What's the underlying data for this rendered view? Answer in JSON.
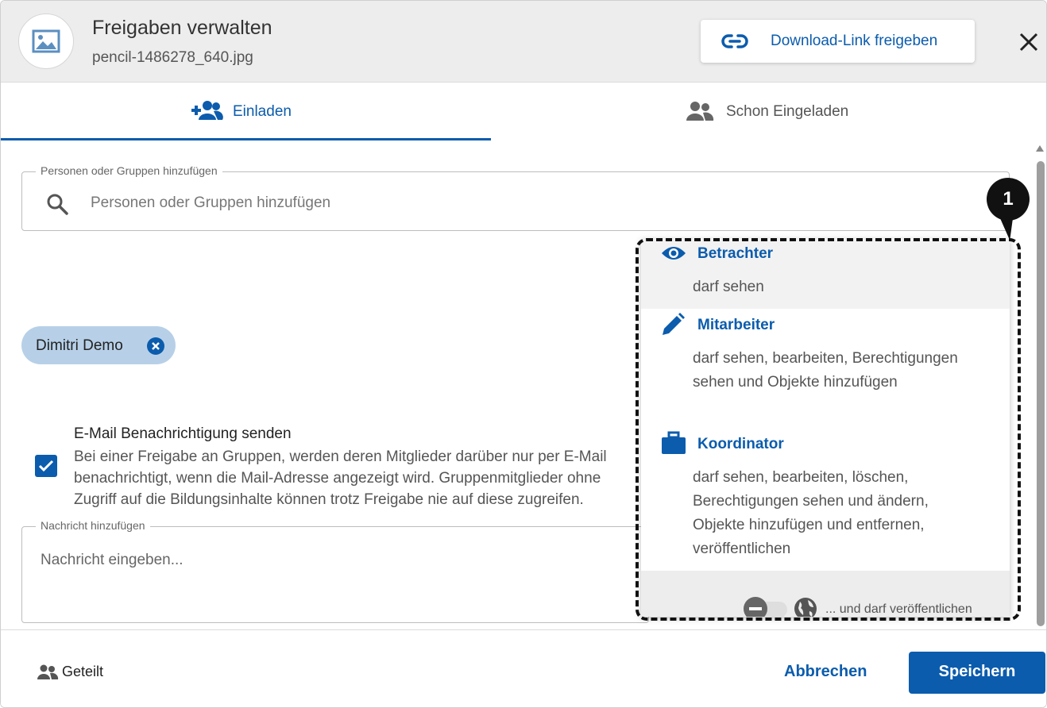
{
  "header": {
    "title": "Freigaben verwalten",
    "filename": "pencil-1486278_640.jpg",
    "download_link_label": "Download-Link freigeben"
  },
  "tabs": [
    {
      "label": "Einladen",
      "icon": "add-group-icon",
      "active": true
    },
    {
      "label": "Schon Eingeladen",
      "icon": "group-icon",
      "active": false
    }
  ],
  "search": {
    "legend": "Personen oder Gruppen hinzufügen",
    "placeholder": "Personen oder Gruppen hinzufügen"
  },
  "chips": [
    {
      "label": "Dimitri Demo"
    }
  ],
  "email": {
    "checked": true,
    "title": "E-Mail Benachrichtigung senden",
    "description": "Bei einer Freigabe an Gruppen, werden deren Mitglieder darüber nur per E-Mail benachrichtigt, wenn die Mail-Adresse angezeigt wird. Gruppenmitglieder ohne Zugriff auf die Bildungsinhalte können trotz Freigabe nie auf diese zugreifen."
  },
  "message": {
    "legend": "Nachricht hinzufügen",
    "placeholder": "Nachricht eingeben..."
  },
  "roles": [
    {
      "name": "Betrachter",
      "icon": "eye-icon",
      "description": "darf sehen"
    },
    {
      "name": "Mitarbeiter",
      "icon": "pencil-icon",
      "description": "darf sehen, bearbeiten, Berechtigungen sehen und Objekte hinzufügen"
    },
    {
      "name": "Koordinator",
      "icon": "briefcase-icon",
      "description": "darf sehen, bearbeiten, löschen, Berechtigungen sehen und ändern, Objekte hinzufügen und entfernen, veröffentlichen"
    }
  ],
  "publish": {
    "label": "... und darf veröffentlichen",
    "enabled": false
  },
  "callout": {
    "number": "1"
  },
  "footer": {
    "shared_label": "Geteilt",
    "cancel_label": "Abbrechen",
    "save_label": "Speichern"
  },
  "colors": {
    "accent": "#0b5cad",
    "chip_bg": "#b7d0e8",
    "header_bg": "#ededed"
  }
}
